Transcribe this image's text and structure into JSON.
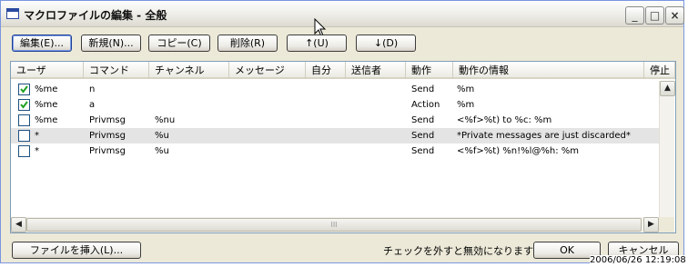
{
  "window": {
    "title": "マクロファイルの編集 - 全般",
    "controls": {
      "minimize": "_",
      "maximize": "□",
      "close": "×"
    }
  },
  "toolbar": {
    "edit_label": "編集(E)...",
    "new_label": "新規(N)...",
    "copy_label": "コピー(C)",
    "delete_label": "削除(R)",
    "up_label": "↑(U)",
    "down_label": "↓(D)"
  },
  "table": {
    "columns": [
      "ユーザ",
      "コマンド",
      "チャンネル",
      "メッセージ",
      "自分",
      "送信者",
      "動作",
      "動作の情報",
      "停止"
    ],
    "rows": [
      {
        "checked": true,
        "user": "%me",
        "command": "n",
        "channel": "",
        "action": "Send",
        "info": "%m"
      },
      {
        "checked": true,
        "user": "%me",
        "command": "a",
        "channel": "",
        "action": "Action",
        "info": "%m"
      },
      {
        "checked": false,
        "user": "%me",
        "command": "Privmsg",
        "channel": "%nu",
        "action": "Send",
        "info": "<%f>%t) to %c: %m"
      },
      {
        "checked": false,
        "user": "*",
        "command": "Privmsg",
        "channel": "%u",
        "action": "Send",
        "info": "*Private messages are just discarded*"
      },
      {
        "checked": false,
        "user": "*",
        "command": "Privmsg",
        "channel": "%u",
        "action": "Send",
        "info": "<%f>%t) %n!%l@%h: %m"
      }
    ],
    "selected_row": 3
  },
  "scrollbar": {
    "thumb_grip": "III"
  },
  "footer": {
    "insert_file_label": "ファイルを挿入(L)...",
    "note": "チェックを外すと無効になります",
    "ok_label": "OK",
    "cancel_label": "キャンセル"
  },
  "timestamp": "2006/06/26 12:19:08",
  "colors": {
    "check": "#21a121",
    "selected_row": "#e4e4e4",
    "accent": "#1c3f94"
  }
}
